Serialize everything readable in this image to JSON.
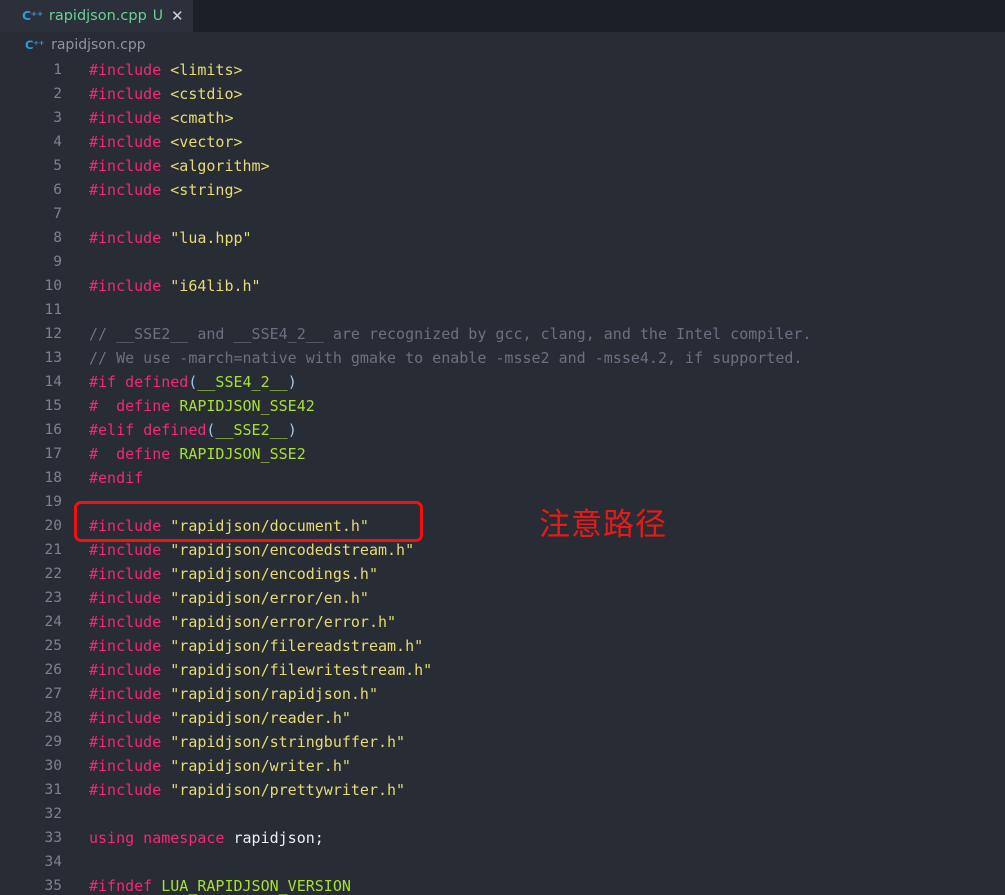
{
  "tab": {
    "icon": "cpp-file-icon",
    "icon_glyph": "C⁺⁺",
    "label": "rapidjson.cpp",
    "dirty_badge": "U",
    "close_glyph": "✕"
  },
  "breadcrumb": {
    "icon_glyph": "C⁺⁺",
    "label": "rapidjson.cpp"
  },
  "annotations": {
    "note_text": "注意路径",
    "note_color": "#e81a17",
    "box_color": "#f21010"
  },
  "theme": {
    "editor_background": "#282c34",
    "tabbar_background": "#1d1f27",
    "active_tab_background": "#2c303a",
    "line_number_color": "#7c828f",
    "preprocessor_color": "#f92672",
    "string_color": "#e6db74",
    "macro_color": "#a6e22e",
    "comment_color": "#6b7180",
    "identifier_color": "#eceef2"
  },
  "editor": {
    "language": "cpp",
    "lines": [
      {
        "n": "1",
        "tokens": [
          {
            "t": "#include ",
            "c": "t-pp"
          },
          {
            "t": "<limits>",
            "c": "t-str"
          }
        ]
      },
      {
        "n": "2",
        "tokens": [
          {
            "t": "#include ",
            "c": "t-pp"
          },
          {
            "t": "<cstdio>",
            "c": "t-str"
          }
        ]
      },
      {
        "n": "3",
        "tokens": [
          {
            "t": "#include ",
            "c": "t-pp"
          },
          {
            "t": "<cmath>",
            "c": "t-str"
          }
        ]
      },
      {
        "n": "4",
        "tokens": [
          {
            "t": "#include ",
            "c": "t-pp"
          },
          {
            "t": "<vector>",
            "c": "t-str"
          }
        ]
      },
      {
        "n": "5",
        "tokens": [
          {
            "t": "#include ",
            "c": "t-pp"
          },
          {
            "t": "<algorithm>",
            "c": "t-str"
          }
        ]
      },
      {
        "n": "6",
        "tokens": [
          {
            "t": "#include ",
            "c": "t-pp"
          },
          {
            "t": "<string>",
            "c": "t-str"
          }
        ]
      },
      {
        "n": "7",
        "tokens": []
      },
      {
        "n": "8",
        "tokens": [
          {
            "t": "#include ",
            "c": "t-pp"
          },
          {
            "t": "\"lua.hpp\"",
            "c": "t-str"
          }
        ]
      },
      {
        "n": "9",
        "tokens": []
      },
      {
        "n": "10",
        "tokens": [
          {
            "t": "#include ",
            "c": "t-pp"
          },
          {
            "t": "\"i64lib.h\"",
            "c": "t-str"
          }
        ]
      },
      {
        "n": "11",
        "tokens": []
      },
      {
        "n": "12",
        "tokens": [
          {
            "t": "// __SSE2__ and __SSE4_2__ are recognized by gcc, clang, and the Intel compiler.",
            "c": "t-cmt"
          }
        ]
      },
      {
        "n": "13",
        "tokens": [
          {
            "t": "// We use -march=native with gmake to enable -msse2 and -msse4.2, if supported.",
            "c": "t-cmt"
          }
        ]
      },
      {
        "n": "14",
        "tokens": [
          {
            "t": "#if ",
            "c": "t-pp"
          },
          {
            "t": "defined",
            "c": "t-pp"
          },
          {
            "t": "(",
            "c": "t-punct"
          },
          {
            "t": "__SSE4_2__",
            "c": "t-macro"
          },
          {
            "t": ")",
            "c": "t-punct"
          }
        ]
      },
      {
        "n": "15",
        "tokens": [
          {
            "t": "#  define ",
            "c": "t-pp"
          },
          {
            "t": "RAPIDJSON_SSE42",
            "c": "t-macro"
          }
        ]
      },
      {
        "n": "16",
        "tokens": [
          {
            "t": "#elif ",
            "c": "t-pp"
          },
          {
            "t": "defined",
            "c": "t-pp"
          },
          {
            "t": "(",
            "c": "t-punct"
          },
          {
            "t": "__SSE2__",
            "c": "t-macro"
          },
          {
            "t": ")",
            "c": "t-punct"
          }
        ]
      },
      {
        "n": "17",
        "tokens": [
          {
            "t": "#  define ",
            "c": "t-pp"
          },
          {
            "t": "RAPIDJSON_SSE2",
            "c": "t-macro"
          }
        ]
      },
      {
        "n": "18",
        "tokens": [
          {
            "t": "#endif",
            "c": "t-pp"
          }
        ]
      },
      {
        "n": "19",
        "tokens": []
      },
      {
        "n": "20",
        "tokens": [
          {
            "t": "#include ",
            "c": "t-pp"
          },
          {
            "t": "\"rapidjson/document.h\"",
            "c": "t-str"
          }
        ]
      },
      {
        "n": "21",
        "tokens": [
          {
            "t": "#include ",
            "c": "t-pp"
          },
          {
            "t": "\"rapidjson/encodedstream.h\"",
            "c": "t-str"
          }
        ]
      },
      {
        "n": "22",
        "tokens": [
          {
            "t": "#include ",
            "c": "t-pp"
          },
          {
            "t": "\"rapidjson/encodings.h\"",
            "c": "t-str"
          }
        ]
      },
      {
        "n": "23",
        "tokens": [
          {
            "t": "#include ",
            "c": "t-pp"
          },
          {
            "t": "\"rapidjson/error/en.h\"",
            "c": "t-str"
          }
        ]
      },
      {
        "n": "24",
        "tokens": [
          {
            "t": "#include ",
            "c": "t-pp"
          },
          {
            "t": "\"rapidjson/error/error.h\"",
            "c": "t-str"
          }
        ]
      },
      {
        "n": "25",
        "tokens": [
          {
            "t": "#include ",
            "c": "t-pp"
          },
          {
            "t": "\"rapidjson/filereadstream.h\"",
            "c": "t-str"
          }
        ]
      },
      {
        "n": "26",
        "tokens": [
          {
            "t": "#include ",
            "c": "t-pp"
          },
          {
            "t": "\"rapidjson/filewritestream.h\"",
            "c": "t-str"
          }
        ]
      },
      {
        "n": "27",
        "tokens": [
          {
            "t": "#include ",
            "c": "t-pp"
          },
          {
            "t": "\"rapidjson/rapidjson.h\"",
            "c": "t-str"
          }
        ]
      },
      {
        "n": "28",
        "tokens": [
          {
            "t": "#include ",
            "c": "t-pp"
          },
          {
            "t": "\"rapidjson/reader.h\"",
            "c": "t-str"
          }
        ]
      },
      {
        "n": "29",
        "tokens": [
          {
            "t": "#include ",
            "c": "t-pp"
          },
          {
            "t": "\"rapidjson/stringbuffer.h\"",
            "c": "t-str"
          }
        ]
      },
      {
        "n": "30",
        "tokens": [
          {
            "t": "#include ",
            "c": "t-pp"
          },
          {
            "t": "\"rapidjson/writer.h\"",
            "c": "t-str"
          }
        ]
      },
      {
        "n": "31",
        "tokens": [
          {
            "t": "#include ",
            "c": "t-pp"
          },
          {
            "t": "\"rapidjson/prettywriter.h\"",
            "c": "t-str"
          }
        ]
      },
      {
        "n": "32",
        "tokens": []
      },
      {
        "n": "33",
        "tokens": [
          {
            "t": "using namespace ",
            "c": "t-pp"
          },
          {
            "t": "rapidjson",
            "c": "t-id"
          },
          {
            "t": ";",
            "c": "t-id"
          }
        ]
      },
      {
        "n": "34",
        "tokens": []
      },
      {
        "n": "35",
        "tokens": [
          {
            "t": "#ifndef ",
            "c": "t-pp"
          },
          {
            "t": "LUA_RAPIDJSON_VERSION",
            "c": "t-macro"
          }
        ]
      }
    ]
  }
}
